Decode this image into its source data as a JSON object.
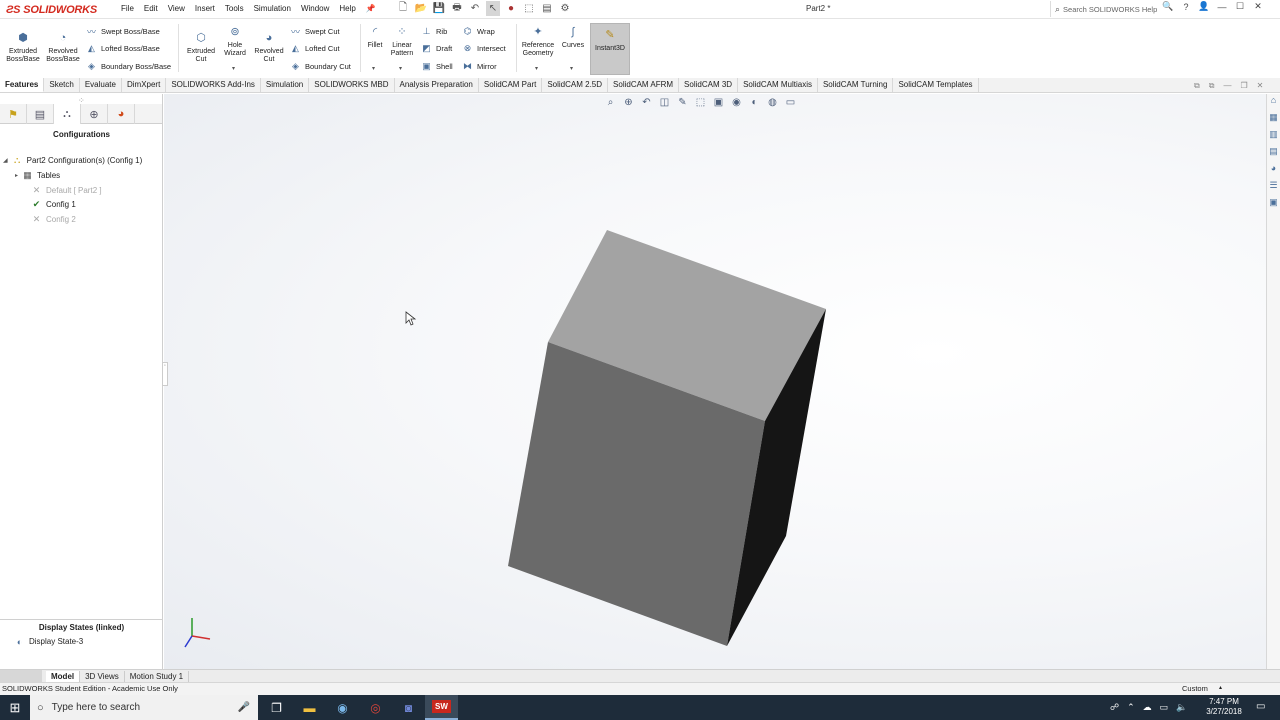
{
  "app": {
    "logo_text": "SOLIDWORKS",
    "doc_title": "Part2 *"
  },
  "menu": [
    "File",
    "Edit",
    "View",
    "Insert",
    "Tools",
    "Simulation",
    "Window",
    "Help"
  ],
  "search": {
    "placeholder": "Search SOLIDWORKS Help"
  },
  "ribbon": {
    "extruded_boss": "Extruded Boss/Base",
    "revolved_boss": "Revolved Boss/Base",
    "swept_boss": "Swept Boss/Base",
    "lofted_boss": "Lofted Boss/Base",
    "boundary_boss": "Boundary Boss/Base",
    "extruded_cut": "Extruded Cut",
    "hole_wizard": "Hole Wizard",
    "revolved_cut": "Revolved Cut",
    "swept_cut": "Swept Cut",
    "lofted_cut": "Lofted Cut",
    "boundary_cut": "Boundary Cut",
    "fillet": "Fillet",
    "linear_pattern": "Linear Pattern",
    "rib": "Rib",
    "draft": "Draft",
    "shell": "Shell",
    "wrap": "Wrap",
    "intersect": "Intersect",
    "mirror": "Mirror",
    "reference_geometry": "Reference Geometry",
    "curves": "Curves",
    "instant3d": "Instant3D"
  },
  "tabs": [
    "Features",
    "Sketch",
    "Evaluate",
    "DimXpert",
    "SOLIDWORKS Add-Ins",
    "Simulation",
    "SOLIDWORKS MBD",
    "Analysis Preparation",
    "SolidCAM Part",
    "SolidCAM 2.5D",
    "SolidCAM AFRM",
    "SolidCAM 3D",
    "SolidCAM Multiaxis",
    "SolidCAM Turning",
    "SolidCAM Templates"
  ],
  "panel": {
    "title": "Configurations",
    "root": "Part2 Configuration(s)  (Config 1)",
    "tables": "Tables",
    "default": "Default [ Part2 ]",
    "config1": "Config 1",
    "config2": "Config 2",
    "display_states_title": "Display States (linked)",
    "display_state": "Display State-3"
  },
  "bottom_tabs": [
    "Model",
    "3D Views",
    "Motion Study 1"
  ],
  "status": {
    "text": "SOLIDWORKS Student Edition - Academic Use Only",
    "units": "Custom"
  },
  "taskbar": {
    "search_placeholder": "Type here to search",
    "time": "7:47 PM",
    "date": "3/27/2018"
  },
  "colors": {
    "logo_red": "#d42a1f",
    "taskbar": "#1e2c3a",
    "box_top": "#a3a3a3",
    "box_front": "#6a6a6a",
    "box_side": "#151515"
  }
}
